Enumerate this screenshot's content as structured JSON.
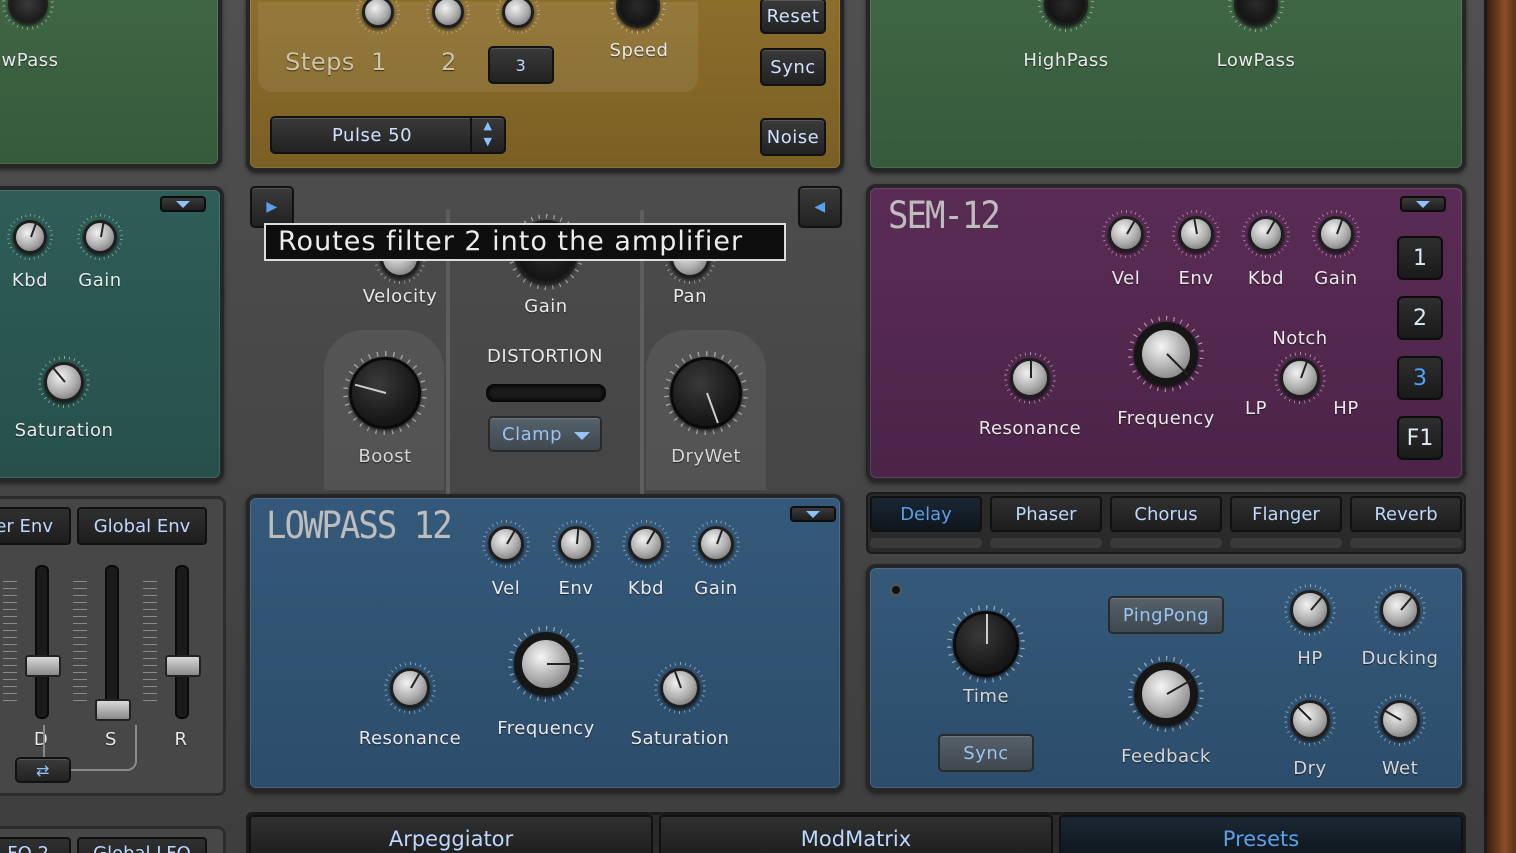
{
  "tooltip": "Routes filter 2 into the amplifier",
  "top_left": {
    "label": "wPass"
  },
  "sequencer": {
    "steps_label": "Steps",
    "step1": "1",
    "step2": "2",
    "step3": "3",
    "speed_label": "Speed",
    "reset": "Reset",
    "sync": "Sync",
    "noise": "Noise",
    "waveform": "Pulse 50"
  },
  "filters_top": {
    "highpass": "HighPass",
    "lowpass": "LowPass"
  },
  "teal_filter": {
    "kbd": "Kbd",
    "gain": "Gain",
    "saturation": "Saturation"
  },
  "amp": {
    "velocity": "Velocity",
    "gain": "Gain",
    "pan": "Pan",
    "boost": "Boost",
    "distortion": "DISTORTION",
    "clamp": "Clamp",
    "drywet": "DryWet"
  },
  "sem": {
    "title": "SEM-12",
    "vel": "Vel",
    "env": "Env",
    "kbd": "Kbd",
    "gain": "Gain",
    "resonance": "Resonance",
    "frequency": "Frequency",
    "notch": "Notch",
    "lp": "LP",
    "hp": "HP",
    "routes": [
      "1",
      "2",
      "3",
      "F1"
    ],
    "selected_route": "3"
  },
  "lowpass": {
    "title": "LOWPASS 12",
    "vel": "Vel",
    "env": "Env",
    "kbd": "Kbd",
    "gain": "Gain",
    "resonance": "Resonance",
    "frequency": "Frequency",
    "saturation": "Saturation"
  },
  "env": {
    "tab1": "er Env",
    "tab2": "Global Env",
    "d": "D",
    "s": "S",
    "r": "R"
  },
  "lfo": {
    "tab1": "FO 2",
    "tab2": "Global LFO"
  },
  "fx_tabs": [
    "Delay",
    "Phaser",
    "Chorus",
    "Flanger",
    "Reverb"
  ],
  "delay": {
    "time": "Time",
    "sync": "Sync",
    "pingpong": "PingPong",
    "feedback": "Feedback",
    "hp": "HP",
    "ducking": "Ducking",
    "dry": "Dry",
    "wet": "Wet"
  },
  "bottom_tabs": [
    "Arpeggiator",
    "ModMatrix",
    "Presets"
  ],
  "colors": {
    "accent": "#4aa3ff",
    "green": "#3f6645",
    "gold": "#8d6f2c",
    "purple": "#5a2c55",
    "blue": "#35597a",
    "teal": "#2e5d57"
  }
}
